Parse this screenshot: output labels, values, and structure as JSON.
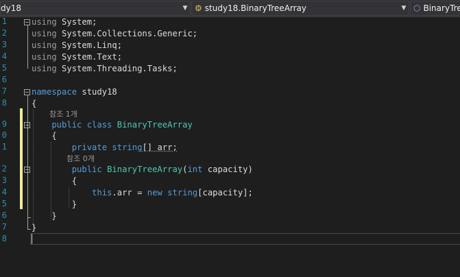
{
  "navbar": {
    "project": "dy18",
    "type": "study18.BinaryTreeArray",
    "member": "BinaryTreeArray"
  },
  "editor": {
    "line_numbers": [
      "1",
      "2",
      "3",
      "4",
      "5",
      "6",
      "7",
      "8",
      "9",
      "0",
      "1",
      "2",
      "3",
      "4",
      "5",
      "6",
      "7",
      "8"
    ],
    "codelens": [
      "참조 1개",
      "참조 0개"
    ],
    "lines": [
      [
        [
          "kw-dim",
          "using"
        ],
        [
          "tx",
          " System;"
        ]
      ],
      [
        [
          "kw-dim",
          "using"
        ],
        [
          "tx",
          " System.Collections.Generic;"
        ]
      ],
      [
        [
          "kw-dim",
          "using"
        ],
        [
          "tx",
          " System.Linq;"
        ]
      ],
      [
        [
          "kw-dim",
          "using"
        ],
        [
          "tx",
          " System.Text;"
        ]
      ],
      [
        [
          "kw-dim",
          "using"
        ],
        [
          "tx",
          " System.Threading.Tasks;"
        ]
      ],
      [],
      [
        [
          "kw",
          "namespace"
        ],
        [
          "tx",
          " study18"
        ]
      ],
      [
        [
          "tx",
          "{"
        ]
      ],
      [
        [
          "kw",
          "    public class "
        ],
        [
          "ty",
          "BinaryTreeArray"
        ]
      ],
      [
        [
          "tx",
          "    {"
        ]
      ],
      [
        [
          "kw",
          "        private string"
        ],
        [
          "tx",
          "[] arr;"
        ]
      ],
      [
        [
          "kw",
          "        public "
        ],
        [
          "ty",
          "BinaryTreeArray"
        ],
        [
          "tx",
          "("
        ],
        [
          "kw",
          "int"
        ],
        [
          "tx",
          " capacity)"
        ]
      ],
      [
        [
          "tx",
          "        {"
        ]
      ],
      [
        [
          "kw",
          "            this"
        ],
        [
          "tx",
          ".arr = "
        ],
        [
          "kw",
          "new string"
        ],
        [
          "tx",
          "[capacity];"
        ]
      ],
      [
        [
          "tx",
          "        }"
        ]
      ],
      [
        [
          "tx",
          "    }"
        ]
      ],
      [
        [
          "tx",
          "}"
        ]
      ],
      []
    ]
  },
  "colors": {
    "background": "#1e1e1e",
    "keyword": "#569cd6",
    "type": "#4ec9b0",
    "line_number": "#2b91af",
    "change_marker": "#efef91"
  }
}
